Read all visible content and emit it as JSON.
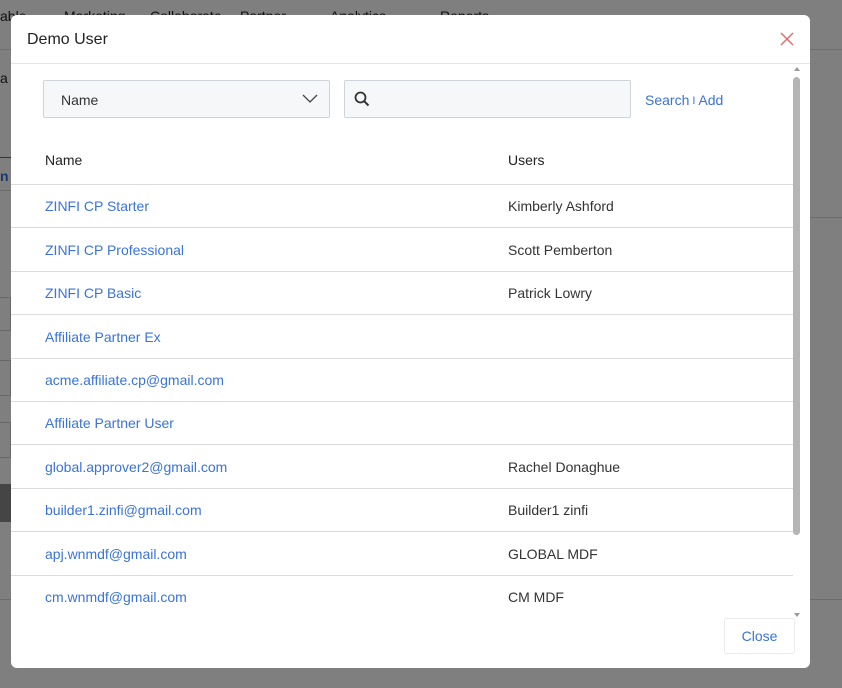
{
  "background": {
    "nav_items": [
      "able",
      "Marketing",
      "Collaborate",
      "Partner",
      "Analytics",
      "Reports"
    ],
    "left_fragments": [
      "a l",
      "n"
    ]
  },
  "modal": {
    "title": "Demo User",
    "filter": {
      "selected": "Name"
    },
    "search": {
      "value": "",
      "placeholder": ""
    },
    "search_link": "Search",
    "separator": "I",
    "add_link": "Add",
    "close_label": "Close"
  },
  "table": {
    "headers": {
      "name": "Name",
      "users": "Users"
    },
    "rows": [
      {
        "name": "ZINFI CP Starter",
        "users": "Kimberly Ashford"
      },
      {
        "name": "ZINFI CP Professional",
        "users": "Scott Pemberton"
      },
      {
        "name": "ZINFI CP Basic",
        "users": "Patrick Lowry"
      },
      {
        "name": "Affiliate Partner Ex",
        "users": ""
      },
      {
        "name": "acme.affiliate.cp@gmail.com",
        "users": ""
      },
      {
        "name": "Affiliate Partner User",
        "users": ""
      },
      {
        "name": "global.approver2@gmail.com",
        "users": "Rachel Donaghue"
      },
      {
        "name": "builder1.zinfi@gmail.com",
        "users": "Builder1 zinfi"
      },
      {
        "name": "apj.wnmdf@gmail.com",
        "users": "GLOBAL MDF"
      },
      {
        "name": "cm.wnmdf@gmail.com",
        "users": "CM MDF"
      }
    ]
  },
  "colors": {
    "link": "#3a73d9",
    "close_x": "#e06c6c"
  }
}
